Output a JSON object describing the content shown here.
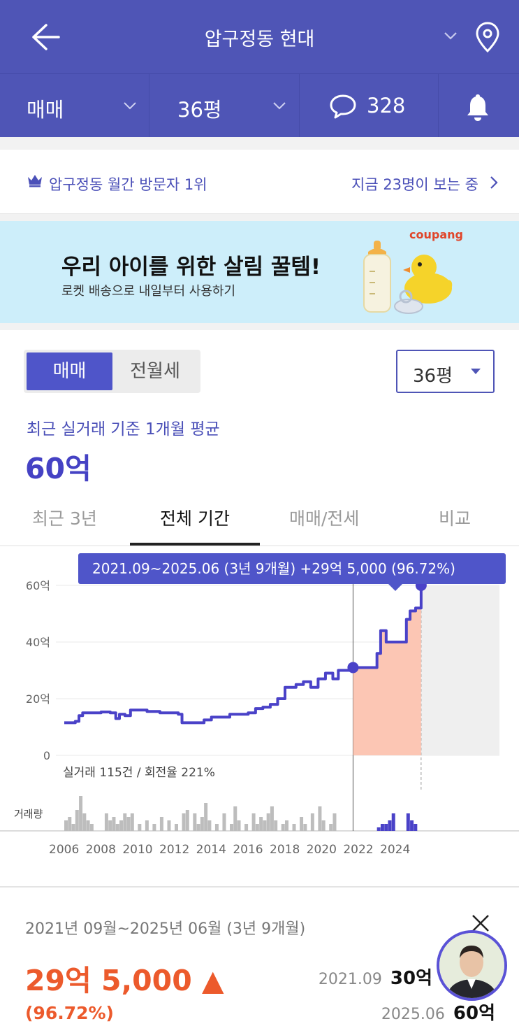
{
  "header": {
    "title": "압구정동 현대"
  },
  "subbar": {
    "deal": "매매",
    "size": "36평",
    "comments": "328"
  },
  "visit": {
    "rank": "압구정동 월간 방문자 1위",
    "viewers": "지금 23명이 보는 중"
  },
  "ad": {
    "headline": "우리 아이를 위한 살림 꿀템!",
    "sub": "로켓 배송으로 내일부터 사용하기",
    "brand": "coupang"
  },
  "toggle": {
    "on": "매매",
    "off": "전월세"
  },
  "size_select": {
    "value": "36평"
  },
  "avg": {
    "label": "최근 실거래 기준 1개월 평균",
    "value": "60억"
  },
  "tabs": [
    "최근 3년",
    "전체 기간",
    "매매/전세",
    "비교"
  ],
  "tooltip": {
    "text": "2021.09~2025.06 (3년 9개월)   +29억 5,000 (96.72%)"
  },
  "stats": {
    "text": "실거래 115건 / 회전율 221%",
    "volume_label": "거래량"
  },
  "chart_data": {
    "type": "line",
    "y_ticks": [
      "60억",
      "40억",
      "20억",
      "0"
    ],
    "x_ticks": [
      "2006",
      "2008",
      "2010",
      "2012",
      "2014",
      "2016",
      "2018",
      "2020",
      "2022",
      "2024"
    ],
    "ylim": [
      0,
      60
    ],
    "series": [
      {
        "values": [
          [
            2006.0,
            11.5
          ],
          [
            2006.6,
            12
          ],
          [
            2006.8,
            14
          ],
          [
            2007.0,
            15
          ],
          [
            2008.0,
            15.3
          ],
          [
            2008.5,
            15
          ],
          [
            2008.8,
            13
          ],
          [
            2009.0,
            14.5
          ],
          [
            2009.3,
            14
          ],
          [
            2009.6,
            16
          ],
          [
            2010.5,
            15.5
          ],
          [
            2011.2,
            15
          ],
          [
            2012.2,
            14.5
          ],
          [
            2012.4,
            11.5
          ],
          [
            2013.0,
            11.5
          ],
          [
            2013.6,
            12.5
          ],
          [
            2014.0,
            13.5
          ],
          [
            2015.0,
            14.5
          ],
          [
            2016.0,
            15
          ],
          [
            2016.4,
            16.5
          ],
          [
            2016.8,
            17
          ],
          [
            2017.2,
            18
          ],
          [
            2017.6,
            20
          ],
          [
            2018.0,
            24
          ],
          [
            2018.6,
            25
          ],
          [
            2019.0,
            26
          ],
          [
            2019.4,
            24
          ],
          [
            2019.8,
            27
          ],
          [
            2020.2,
            29
          ],
          [
            2020.6,
            27
          ],
          [
            2020.9,
            30
          ],
          [
            2021.7,
            31
          ],
          [
            2022.5,
            31
          ],
          [
            2023.0,
            36
          ],
          [
            2023.2,
            44
          ],
          [
            2023.5,
            40
          ],
          [
            2024.5,
            40
          ],
          [
            2024.6,
            48
          ],
          [
            2024.8,
            51
          ],
          [
            2025.1,
            52
          ],
          [
            2025.4,
            60
          ]
        ]
      }
    ],
    "highlight": {
      "from": 2021.7,
      "to": 2025.4
    },
    "volume": [
      [
        2006.0,
        3
      ],
      [
        2006.2,
        4
      ],
      [
        2006.4,
        2
      ],
      [
        2006.6,
        6
      ],
      [
        2006.8,
        10
      ],
      [
        2007.0,
        5
      ],
      [
        2007.2,
        3
      ],
      [
        2007.4,
        2
      ],
      [
        2008.2,
        5
      ],
      [
        2008.4,
        3
      ],
      [
        2008.6,
        4
      ],
      [
        2008.8,
        2
      ],
      [
        2009.0,
        3
      ],
      [
        2009.2,
        5
      ],
      [
        2009.4,
        4
      ],
      [
        2009.6,
        5
      ],
      [
        2010.0,
        2
      ],
      [
        2010.4,
        3
      ],
      [
        2010.8,
        2
      ],
      [
        2011.2,
        4
      ],
      [
        2011.6,
        3
      ],
      [
        2012.0,
        2
      ],
      [
        2012.4,
        5
      ],
      [
        2012.6,
        6
      ],
      [
        2013.0,
        5
      ],
      [
        2013.2,
        2
      ],
      [
        2013.4,
        4
      ],
      [
        2013.6,
        8
      ],
      [
        2013.8,
        3
      ],
      [
        2014.2,
        2
      ],
      [
        2014.6,
        5
      ],
      [
        2015.0,
        2
      ],
      [
        2015.2,
        7
      ],
      [
        2015.4,
        3
      ],
      [
        2015.8,
        2
      ],
      [
        2016.2,
        5
      ],
      [
        2016.4,
        2
      ],
      [
        2016.6,
        4
      ],
      [
        2016.8,
        3
      ],
      [
        2017.0,
        5
      ],
      [
        2017.2,
        7
      ],
      [
        2017.4,
        3
      ],
      [
        2017.8,
        2
      ],
      [
        2018.0,
        3
      ],
      [
        2018.4,
        2
      ],
      [
        2018.8,
        4
      ],
      [
        2019.0,
        2
      ],
      [
        2019.4,
        5
      ],
      [
        2019.8,
        7
      ],
      [
        2020.0,
        3
      ],
      [
        2020.4,
        2
      ],
      [
        2020.6,
        5
      ],
      [
        2023.0,
        1
      ],
      [
        2023.2,
        2
      ],
      [
        2023.4,
        2
      ],
      [
        2023.6,
        3
      ],
      [
        2023.8,
        5
      ],
      [
        2024.6,
        5
      ],
      [
        2024.8,
        3
      ],
      [
        2025.0,
        2
      ]
    ]
  },
  "bottom": {
    "period": "2021년 09월~2025년 06월 (3년 9개월)",
    "change": "29억 5,000 ▲",
    "pct": "(96.72%)",
    "start_date": "2021.09",
    "start_val": "30억",
    "end_date": "2025.06",
    "end_val": "60억"
  }
}
